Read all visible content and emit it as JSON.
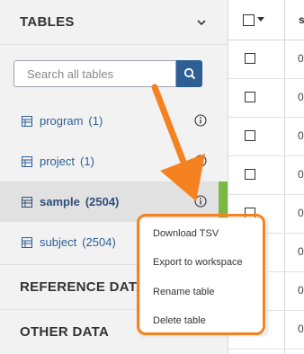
{
  "sidebar": {
    "tables_title": "TABLES",
    "search_placeholder": "Search all tables",
    "tables": [
      {
        "name": "program",
        "count": "(1)"
      },
      {
        "name": "project",
        "count": "(1)"
      },
      {
        "name": "sample",
        "count": "(2504)"
      },
      {
        "name": "subject",
        "count": "(2504)"
      }
    ],
    "reference_title": "REFERENCE DATA",
    "other_title": "OTHER DATA"
  },
  "context_menu": {
    "items": [
      "Download TSV",
      "Export to workspace",
      "Rename table",
      "Delete table"
    ]
  },
  "data_table": {
    "col_head": "s",
    "cell_prefix": "0"
  },
  "colors": {
    "accent": "#2d5f95",
    "highlight": "#f58220",
    "active_bar": "#7bb844"
  },
  "icons": [
    "chevron-down-icon",
    "search-icon",
    "table-icon",
    "info-icon",
    "arrow-icon"
  ]
}
